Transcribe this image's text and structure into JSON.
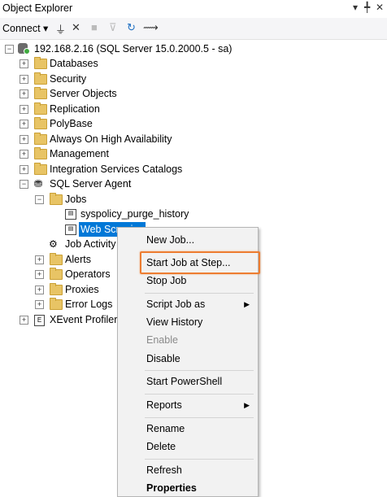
{
  "window": {
    "title": "Object Explorer",
    "pin_glyph": "▾ ╇ ✕"
  },
  "toolbar": {
    "connect_label": "Connect ▾"
  },
  "tree": {
    "server": "192.168.2.16 (SQL Server 15.0.2000.5 - sa)",
    "nodes": [
      "Databases",
      "Security",
      "Server Objects",
      "Replication",
      "PolyBase",
      "Always On High Availability",
      "Management",
      "Integration Services Catalogs"
    ],
    "agent": "SQL Server Agent",
    "jobs": "Jobs",
    "job_items": [
      "syspolicy_purge_history",
      "Web Scraping"
    ],
    "job_activity": "Job Activity",
    "agent_children": [
      "Alerts",
      "Operators",
      "Proxies",
      "Error Logs"
    ],
    "xevent": "XEvent Profiler"
  },
  "menu": {
    "new_job": "New Job...",
    "start_job": "Start Job at Step...",
    "stop_job": "Stop Job",
    "script_job": "Script Job as",
    "view_history": "View History",
    "enable": "Enable",
    "disable": "Disable",
    "start_powershell": "Start PowerShell",
    "reports": "Reports",
    "rename": "Rename",
    "delete": "Delete",
    "refresh": "Refresh",
    "properties": "Properties"
  },
  "colors": {
    "selection": "#0078d7",
    "highlight": "#ed7d31",
    "folder": "#e8c465"
  }
}
